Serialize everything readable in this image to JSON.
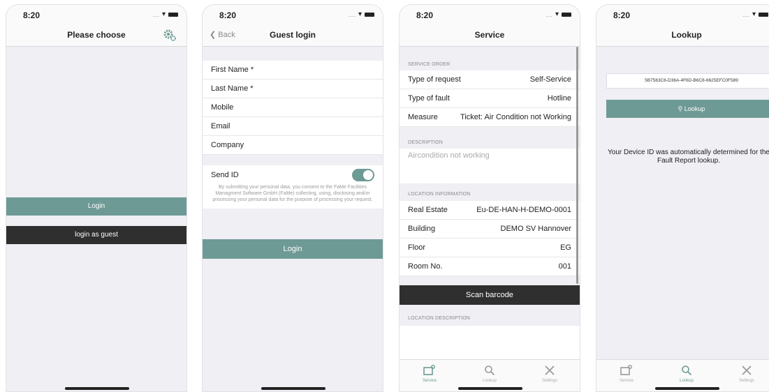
{
  "status_time": "8:20",
  "status_dots": "....",
  "screen1": {
    "title": "Please choose",
    "login_label": "Login",
    "guest_label": "login as guest"
  },
  "screen2": {
    "back_label": "Back",
    "title": "Guest login",
    "fields": [
      "First Name *",
      "Last Name *",
      "Mobile",
      "Email",
      "Company"
    ],
    "send_id_label": "Send ID",
    "send_id_on": true,
    "consent": "By submitting your personal data, you consent to the FaMe Facilities Managment Software GmbH (FaMe) collecting, using, disclosing and/or processing your personal data for the purpose of processing your request.",
    "login_label": "Login"
  },
  "screen3": {
    "title": "Service",
    "service_order_header": "SERVICE ORDER",
    "service_rows": [
      {
        "label": "Type of request",
        "value": "Self-Service"
      },
      {
        "label": "Type of fault",
        "value": "Hotline"
      },
      {
        "label": "Measure",
        "value": "Ticket: Air Condition not Working"
      }
    ],
    "description_header": "DESCRIPTION",
    "description_text": "Aircondition not working",
    "location_header": "LOCATION INFORMATION",
    "location_rows": [
      {
        "label": "Real Estate",
        "value": "Eu-DE-HAN-H-DEMO-0001"
      },
      {
        "label": "Building",
        "value": "DEMO SV Hannover"
      },
      {
        "label": "Floor",
        "value": "EG"
      },
      {
        "label": "Room No.",
        "value": "001"
      }
    ],
    "scan_label": "Scan barcode",
    "location_desc_header": "LOCATION DESCRIPTION"
  },
  "screen4": {
    "title": "Lookup",
    "device_id": "5B7563C6-D36A-4F6D-B6C8-6625EFC0F589",
    "lookup_label": "Lookup",
    "info_text": "Your Device ID was automatically determined for the Fault Report lookup."
  },
  "tabs": [
    {
      "label": "Service",
      "icon": "service-icon"
    },
    {
      "label": "Lookup",
      "icon": "search-icon"
    },
    {
      "label": "Settings",
      "icon": "tools-icon"
    }
  ],
  "colors": {
    "accent": "#6e9a95",
    "dark": "#2f2f2f",
    "background": "#efeff4"
  }
}
